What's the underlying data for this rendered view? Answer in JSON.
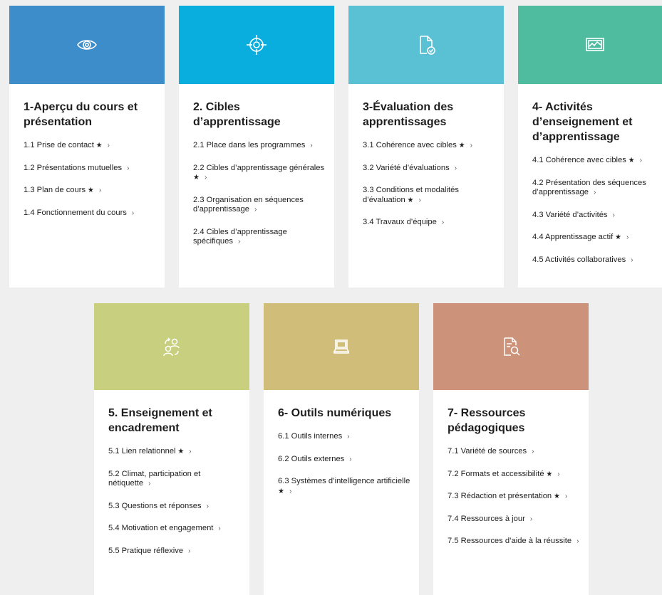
{
  "cards": [
    {
      "title": "1-Aperçu du cours et présentation",
      "color": "#3d8dcb",
      "icon": "eye-icon",
      "items": [
        {
          "label": "1.1 Prise de contact",
          "star": true
        },
        {
          "label": "1.2 Présentations mutuelles",
          "star": false
        },
        {
          "label": "1.3 Plan de cours",
          "star": true
        },
        {
          "label": "1.4 Fonctionnement du cours",
          "star": false
        }
      ]
    },
    {
      "title": "2. Cibles d’apprentissage",
      "color": "#0aaede",
      "icon": "target-icon",
      "items": [
        {
          "label": "2.1 Place dans les programmes",
          "star": false
        },
        {
          "label": "2.2 Cibles d’apprentissage générales",
          "star": true
        },
        {
          "label": "2.3 Organisation en séquences d’apprentissage",
          "star": false
        },
        {
          "label": "2.4 Cibles d’apprentissage spécifiques",
          "star": false
        }
      ]
    },
    {
      "title": "3-Évaluation des apprentissages",
      "color": "#5ac0d4",
      "icon": "document-check-icon",
      "items": [
        {
          "label": "3.1 Cohérence avec cibles",
          "star": true
        },
        {
          "label": "3.2 Variété d’évaluations",
          "star": false
        },
        {
          "label": "3.3 Conditions et modalités d’évaluation",
          "star": true
        },
        {
          "label": "3.4 Travaux d’équipe",
          "star": false
        }
      ]
    },
    {
      "title": "4- Activités d’enseignement et d’apprentissage",
      "color": "#4fbc9f",
      "icon": "monitor-chart-icon",
      "items": [
        {
          "label": "4.1 Cohérence avec cibles",
          "star": true
        },
        {
          "label": "4.2 Présentation des séquences d’apprentissage",
          "star": false
        },
        {
          "label": "4.3 Variété d’activités",
          "star": false
        },
        {
          "label": "4.4 Apprentissage actif",
          "star": true
        },
        {
          "label": "4.5 Activités collaboratives",
          "star": false
        }
      ]
    },
    {
      "title": "5. Enseignement et encadrement",
      "color": "#c8cf7e",
      "icon": "people-exchange-icon",
      "items": [
        {
          "label": "5.1 Lien relationnel",
          "star": true
        },
        {
          "label": "5.2 Climat, participation et nétiquette",
          "star": false
        },
        {
          "label": "5.3 Questions et réponses",
          "star": false
        },
        {
          "label": "5.4 Motivation et engagement",
          "star": false
        },
        {
          "label": "5.5 Pratique réflexive",
          "star": false
        }
      ]
    },
    {
      "title": "6- Outils numériques",
      "color": "#d1bd7a",
      "icon": "laptop-icon",
      "items": [
        {
          "label": "6.1 Outils internes",
          "star": false
        },
        {
          "label": "6.2 Outils externes",
          "star": false
        },
        {
          "label": "6.3 Systèmes d’intelligence artificielle",
          "star": true
        }
      ]
    },
    {
      "title": "7- Ressources pédagogiques",
      "color": "#cd927a",
      "icon": "document-search-icon",
      "items": [
        {
          "label": "7.1 Variété de sources",
          "star": false
        },
        {
          "label": "7.2 Formats et accessibilité",
          "star": true
        },
        {
          "label": "7.3 Rédaction et présentation",
          "star": true
        },
        {
          "label": "7.4 Ressources à jour",
          "star": false
        },
        {
          "label": "7.5 Ressources d’aide à la réussite",
          "star": false
        }
      ]
    }
  ]
}
